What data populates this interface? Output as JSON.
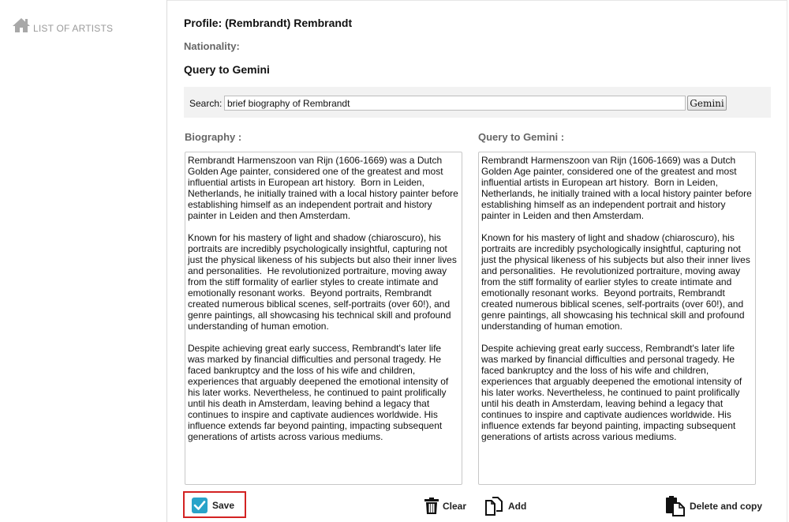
{
  "sidebar": {
    "items": [
      {
        "label": "LIST OF ARTISTS",
        "icon": "home-icon"
      }
    ]
  },
  "profile": {
    "title": "Profile: (Rembrandt) Rembrandt",
    "nationality_label": "Nationality:"
  },
  "query": {
    "title": "Query to Gemini",
    "search_label": "Search:",
    "search_value": "brief biography of Rembrandt",
    "button_label": "Gemini"
  },
  "biography": {
    "label": "Biography :",
    "text": "Rembrandt Harmenszoon van Rijn (1606-1669) was a Dutch Golden Age painter, considered one of the greatest and most influential artists in European art history.  Born in Leiden, Netherlands, he initially trained with a local history painter before establishing himself as an independent portrait and history painter in Leiden and then Amsterdam.\n\nKnown for his mastery of light and shadow (chiaroscuro), his portraits are incredibly psychologically insightful, capturing not just the physical likeness of his subjects but also their inner lives and personalities.  He revolutionized portraiture, moving away from the stiff formality of earlier styles to create intimate and emotionally resonant works.  Beyond portraits, Rembrandt created numerous biblical scenes, self-portraits (over 60!), and genre paintings, all showcasing his technical skill and profound understanding of human emotion.\n\nDespite achieving great early success, Rembrandt's later life was marked by financial difficulties and personal tragedy. He faced bankruptcy and the loss of his wife and children, experiences that arguably deepened the emotional intensity of his later works. Nevertheless, he continued to paint prolifically until his death in Amsterdam, leaving behind a legacy that continues to inspire and captivate audiences worldwide. His influence extends far beyond painting, impacting subsequent generations of artists across various mediums."
  },
  "gemini_result": {
    "label": "Query to Gemini :",
    "text": "Rembrandt Harmenszoon van Rijn (1606-1669) was a Dutch Golden Age painter, considered one of the greatest and most influential artists in European art history.  Born in Leiden, Netherlands, he initially trained with a local history painter before establishing himself as an independent portrait and history painter in Leiden and then Amsterdam.\n\nKnown for his mastery of light and shadow (chiaroscuro), his portraits are incredibly psychologically insightful, capturing not just the physical likeness of his subjects but also their inner lives and personalities.  He revolutionized portraiture, moving away from the stiff formality of earlier styles to create intimate and emotionally resonant works.  Beyond portraits, Rembrandt created numerous biblical scenes, self-portraits (over 60!), and genre paintings, all showcasing his technical skill and profound understanding of human emotion.\n\nDespite achieving great early success, Rembrandt's later life was marked by financial difficulties and personal tragedy. He faced bankruptcy and the loss of his wife and children, experiences that arguably deepened the emotional intensity of his later works. Nevertheless, he continued to paint prolifically until his death in Amsterdam, leaving behind a legacy that continues to inspire and captivate audiences worldwide. His influence extends far beyond painting, impacting subsequent generations of artists across various mediums."
  },
  "actions": {
    "save": {
      "label": "Save",
      "icon": "checkbox-checked-icon"
    },
    "clear": {
      "label": "Clear",
      "icon": "trash-icon"
    },
    "add": {
      "label": "Add",
      "icon": "copy-icon"
    },
    "delete_copy": {
      "label": "Delete and copy",
      "icon": "clipboard-paste-icon"
    }
  },
  "colors": {
    "save_check": "#29a3c9",
    "highlight_border": "#d32222",
    "muted_text": "#666666",
    "sidebar_text": "#9a9a9a"
  }
}
